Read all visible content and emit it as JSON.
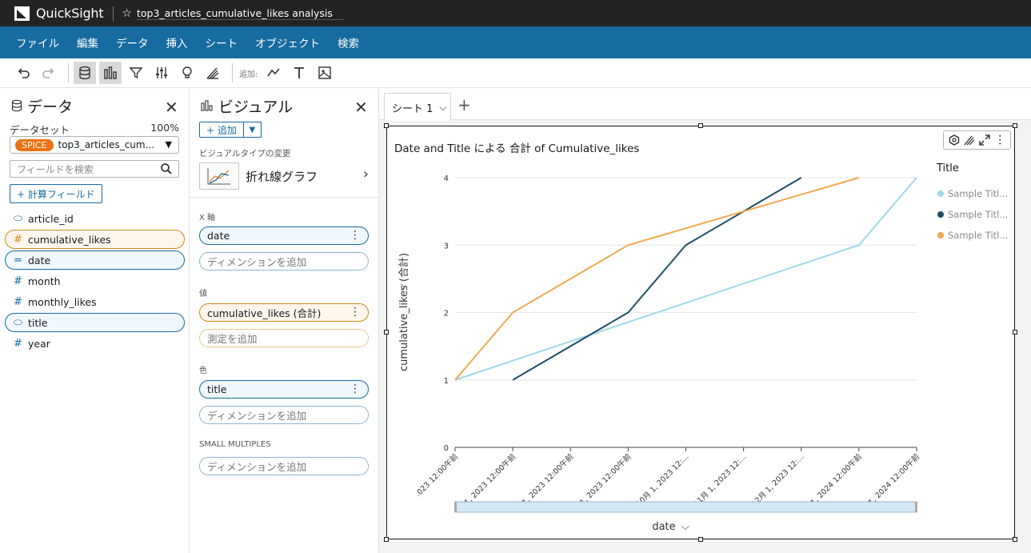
{
  "app": {
    "name": "QuickSight",
    "analysis_name": "top3_articles_cumulative_likes analysis"
  },
  "menu": [
    "ファイル",
    "編集",
    "データ",
    "挿入",
    "シート",
    "オブジェクト",
    "検索"
  ],
  "toolbar": {
    "add_label": "追加:"
  },
  "data_panel": {
    "title": "データ",
    "dataset_label": "データセット",
    "dataset_pct": "100%",
    "spice_badge": "SPICE",
    "dataset_name": "top3_articles_cum...",
    "search_placeholder": "フィールドを検索",
    "calc_field_label": "+ 計算フィールド",
    "fields": [
      {
        "name": "article_id",
        "type": "dim",
        "selected": false
      },
      {
        "name": "cumulative_likes",
        "type": "measure",
        "selected": true
      },
      {
        "name": "date",
        "type": "date",
        "selected": true
      },
      {
        "name": "month",
        "type": "measure",
        "selected": false
      },
      {
        "name": "monthly_likes",
        "type": "measure",
        "selected": false
      },
      {
        "name": "title",
        "type": "dim",
        "selected": true
      },
      {
        "name": "year",
        "type": "measure",
        "selected": false
      }
    ]
  },
  "visual_panel": {
    "title": "ビジュアル",
    "add_label": "+ 追加",
    "visual_type_label": "ビジュアルタイプの変更",
    "visual_type_name": "折れ線グラフ",
    "x_axis_label": "X 軸",
    "x_axis_field": "date",
    "value_label": "値",
    "value_field": "cumulative_likes (合計)",
    "color_label": "色",
    "color_field": "title",
    "small_multiples_label": "SMALL MULTIPLES",
    "add_dimension": "ディメンションを追加",
    "add_measure": "測定を追加"
  },
  "sheets": {
    "active_tab": "シート 1"
  },
  "chart_data": {
    "type": "line",
    "title": "Date and Title による 合計 of Cumulative_likes",
    "xlabel": "date",
    "ylabel": "cumulative_likes (合計)",
    "ylim": [
      0,
      4
    ],
    "yticks": [
      0,
      1,
      2,
      3,
      4
    ],
    "categories": [
      ".023 12:00午前",
      "1, 2023 12:00午前",
      "1, 2023 12:00午前",
      "1, 2023 12:00午前",
      "10月 1, 2023 12:...",
      "11月 1, 2023 12:...",
      "12月 1, 2023 12:...",
      "1, 2024 12:00午前",
      "1, 2024 12:00午前"
    ],
    "legend_title": "Title",
    "legend_position": "right",
    "series": [
      {
        "name": "Sample Titl...",
        "color": "#9fd8ea",
        "values": [
          1,
          null,
          null,
          null,
          null,
          null,
          null,
          3,
          4
        ]
      },
      {
        "name": "Sample Titl...",
        "color": "#1f4e66",
        "values": [
          null,
          1,
          null,
          2,
          3,
          null,
          4,
          null,
          null
        ]
      },
      {
        "name": "Sample Titl...",
        "color": "#f0a94e",
        "values": [
          1,
          2,
          null,
          3,
          null,
          null,
          null,
          4,
          null
        ]
      }
    ],
    "grid": true
  }
}
